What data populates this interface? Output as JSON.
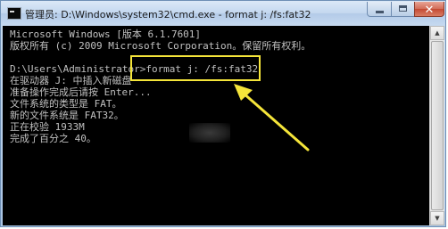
{
  "window": {
    "title": "管理员: D:\\Windows\\system32\\cmd.exe - format  j: /fs:fat32",
    "icon": "cmd-icon"
  },
  "caption_buttons": {
    "minimize": "minimize-icon",
    "maximize": "maximize-icon",
    "close": "close-icon",
    "close_glyph": "✕"
  },
  "console": {
    "lines": [
      "Microsoft Windows [版本 6.1.7601]",
      "版权所有 (c) 2009 Microsoft Corporation。保留所有权利。",
      "",
      "D:\\Users\\Administrator>format j: /fs:fat32",
      "在驱动器 J: 中插入新磁盘",
      "准备操作完成后请按 Enter...",
      "文件系统的类型是 FAT。",
      "新的文件系统是 FAT32。",
      "正在校验 1933M",
      "完成了百分之 40。"
    ]
  },
  "scrollbar": {
    "up": "▲",
    "down": "▼"
  },
  "annotation": {
    "box_color": "#f5e53a",
    "arrow_color": "#f5e53a"
  }
}
